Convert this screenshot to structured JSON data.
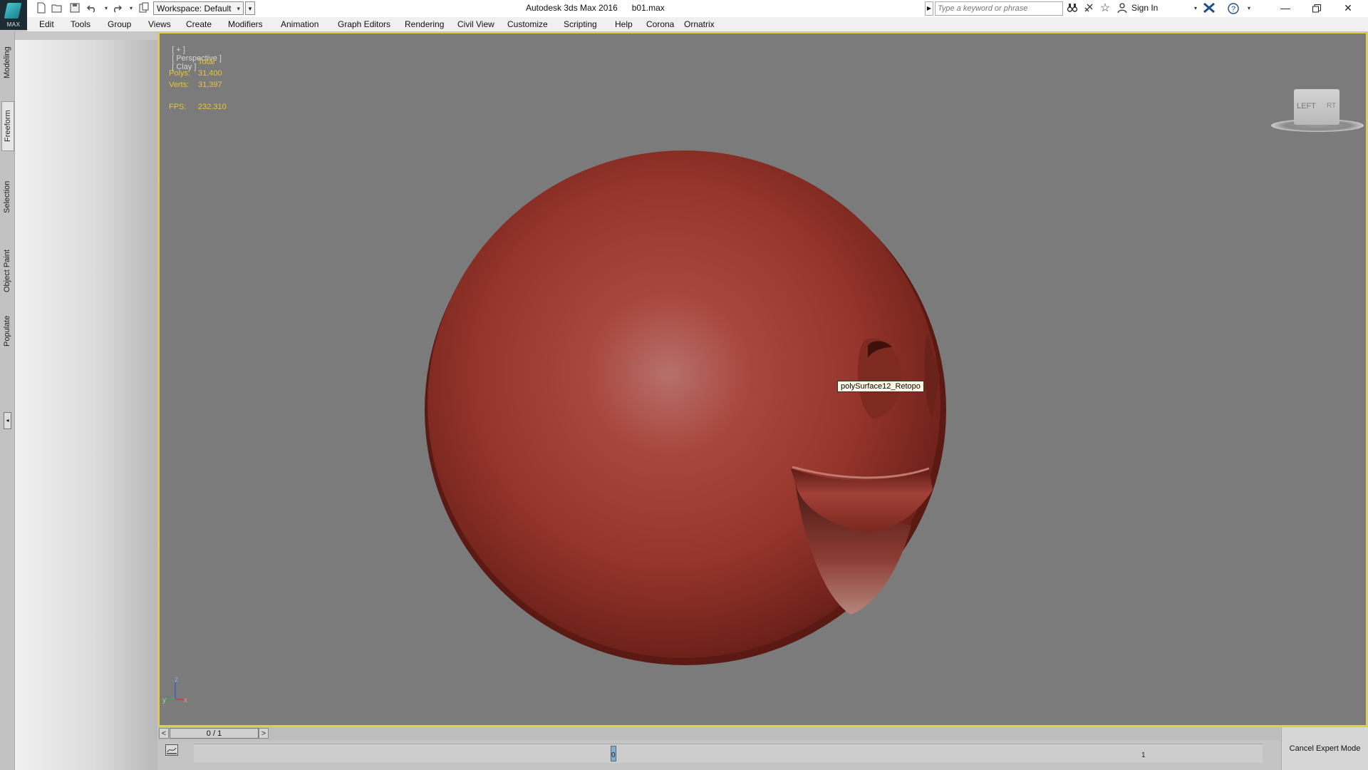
{
  "app": {
    "logo_text": "MAX",
    "title": "Autodesk 3ds Max 2016      b01.max"
  },
  "quick_access": {
    "workspace": "Workspace: Default",
    "icons": [
      "new-file-icon",
      "open-file-icon",
      "save-icon",
      "undo-icon",
      "undo-dropdown-icon",
      "redo-icon",
      "redo-dropdown-icon",
      "project-folder-icon"
    ]
  },
  "search": {
    "placeholder": "Type a keyword or phrase"
  },
  "account": {
    "sign_in": "Sign In"
  },
  "menu": {
    "items": [
      "Edit",
      "Tools",
      "Group",
      "Views",
      "Create",
      "Modifiers",
      "Animation",
      "Graph Editors",
      "Rendering",
      "Civil View",
      "Customize",
      "Scripting",
      "Help",
      "Corona",
      "Ornatrix"
    ]
  },
  "ribbon": {
    "tabs": [
      "Modeling",
      "Freeform",
      "Selection",
      "Object Paint",
      "Populate"
    ],
    "active_tab": "Freeform"
  },
  "viewport": {
    "label_plus": "[ + ]",
    "label_view": "[ Perspective ]",
    "label_shading": "[ Clay ]",
    "stats": {
      "header": "Total",
      "polys_label": "Polys:",
      "polys_value": "31,400",
      "verts_label": "Verts:",
      "verts_value": "31,397",
      "fps_label": "FPS:",
      "fps_value": "232.310"
    },
    "tooltip": "polySurface12_Retopo",
    "viewcube_left": "LEFT",
    "viewcube_right": "RT",
    "axis_x": "x",
    "axis_y": "y",
    "axis_z": "z",
    "colors": {
      "border": "#e4d23a",
      "background": "#7b7b7b",
      "object": "#9a3a30",
      "stats_text": "#e8c43a"
    }
  },
  "timeline": {
    "frame_readout": "0 / 1",
    "prev": "<",
    "next": ">",
    "tick_start": "0",
    "tick_end": "1"
  },
  "expert_mode": {
    "cancel_label": "Cancel Expert Mode"
  }
}
